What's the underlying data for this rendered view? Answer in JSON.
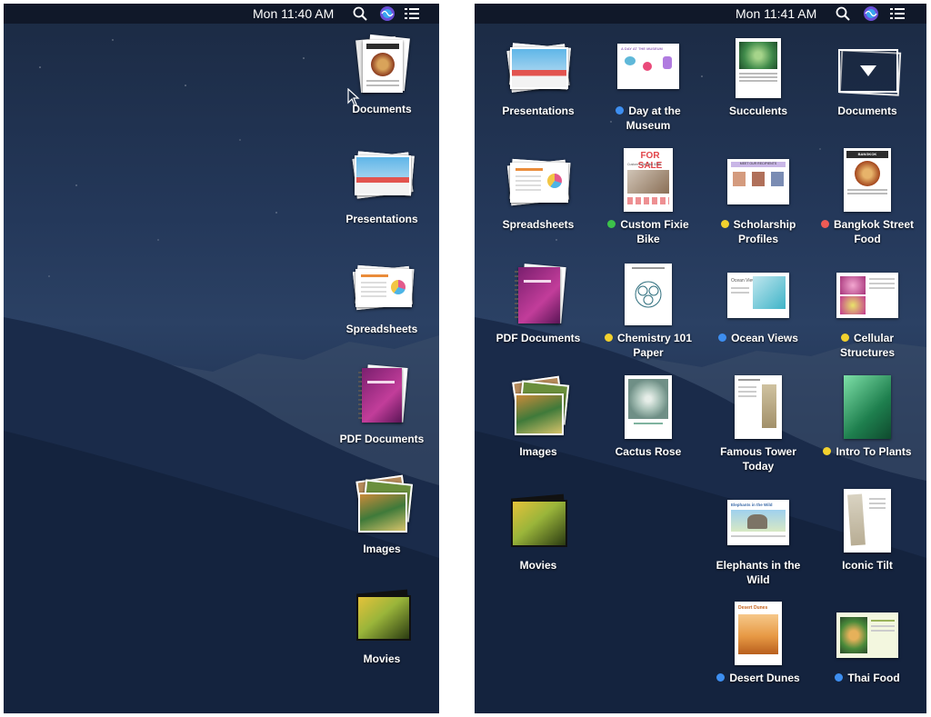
{
  "left_screen": {
    "menubar": {
      "clock": "Mon 11:40 AM",
      "icons": [
        "search-icon",
        "siri-icon",
        "notification-center-icon"
      ]
    },
    "stacks": [
      {
        "label": "Documents",
        "icon": "documents-stack-icon"
      },
      {
        "label": "Presentations",
        "icon": "presentations-stack-icon"
      },
      {
        "label": "Spreadsheets",
        "icon": "spreadsheets-stack-icon"
      },
      {
        "label": "PDF Documents",
        "icon": "pdf-stack-icon"
      },
      {
        "label": "Images",
        "icon": "images-stack-icon"
      },
      {
        "label": "Movies",
        "icon": "movies-stack-icon"
      }
    ]
  },
  "right_screen": {
    "menubar": {
      "clock": "Mon 11:41 AM",
      "icons": [
        "search-icon",
        "siri-icon",
        "notification-center-icon"
      ]
    },
    "items": [
      {
        "label": "Presentations",
        "tag": null
      },
      {
        "label": "Day at the Museum",
        "tag": "#3d8ef0"
      },
      {
        "label": "Succulents",
        "tag": null
      },
      {
        "label": "Documents",
        "tag": null
      },
      {
        "label": "Spreadsheets",
        "tag": null
      },
      {
        "label": "Custom Fixie Bike",
        "tag": "#3cc24a"
      },
      {
        "label": "Scholarship Profiles",
        "tag": "#f2d12e"
      },
      {
        "label": "Bangkok Street Food",
        "tag": "#ee5b55"
      },
      {
        "label": "PDF Documents",
        "tag": null
      },
      {
        "label": "Chemistry 101 Paper",
        "tag": "#f2d12e"
      },
      {
        "label": "Ocean Views",
        "tag": "#3d8ef0"
      },
      {
        "label": "Cellular Structures",
        "tag": "#f2d12e"
      },
      {
        "label": "Images",
        "tag": null
      },
      {
        "label": "Cactus Rose",
        "tag": null
      },
      {
        "label": "Famous Tower Today",
        "tag": null
      },
      {
        "label": "Intro To Plants",
        "tag": "#f2d12e"
      },
      {
        "label": "Movies",
        "tag": null
      },
      {
        "label": "Elephants in the Wild",
        "tag": null
      },
      {
        "label": "Iconic Tilt",
        "tag": null
      },
      {
        "label": "Desert Dunes",
        "tag": "#3d8ef0"
      },
      {
        "label": "Thai Food",
        "tag": "#3d8ef0"
      }
    ],
    "document_titles": {
      "museum": "A DAY AT THE MUSEUM",
      "fixie_header": "FOR SALE",
      "fixie_sub": "Custom Fixie Bike $395",
      "scholarship": "MEET OUR RECIPIENTS",
      "bangkok": "BANGKOK",
      "ocean": "Ocean Views",
      "elephants": "Elephants in the Wild",
      "desert": "Desert Dunes"
    }
  },
  "colors": {
    "tag_blue": "#3d8ef0",
    "tag_green": "#3cc24a",
    "tag_yellow": "#f2d12e",
    "tag_red": "#ee5b55"
  }
}
